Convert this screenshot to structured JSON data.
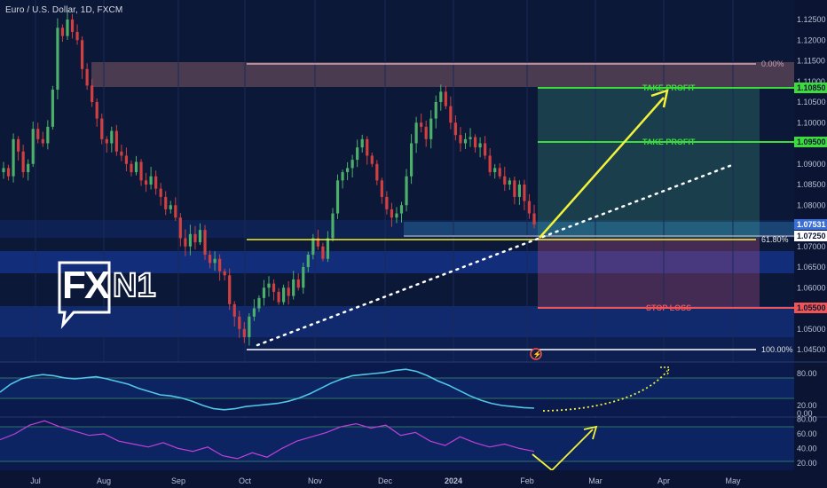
{
  "header": {
    "title": "Euro / U.S. Dollar, 1D, FXCM"
  },
  "logo": {
    "text": "FXN1",
    "part1": "FX",
    "part2": "N1"
  },
  "price_axis": {
    "ticks": [
      "1.12500",
      "1.12000",
      "1.11500",
      "1.11000",
      "1.10500",
      "1.10000",
      "1.09500",
      "1.09000",
      "1.08500",
      "1.08000",
      "1.07500",
      "1.07000",
      "1.06500",
      "1.06000",
      "1.05500",
      "1.05000",
      "1.04500"
    ]
  },
  "price_boxes": {
    "tp_upper": "1.10850",
    "tp_lower": "1.09500",
    "current_1": "1.07531",
    "current_2": "1.07250",
    "stop_loss": "1.05500"
  },
  "levels": {
    "take_profit_1": "TAKE PROFIT",
    "take_profit_2": "TAKE PROFIT",
    "stop_loss": "STOP LOSS",
    "fib_0": "0.00%",
    "fib_618": "61.80%",
    "fib_100": "100.00%"
  },
  "indicator1": {
    "ticks": [
      "80.00",
      "20.00",
      "0.00"
    ]
  },
  "indicator2": {
    "ticks": [
      "80.00",
      "60.00",
      "40.00",
      "20.00"
    ]
  },
  "time_axis": {
    "labels": [
      "Jul",
      "Aug",
      "Sep",
      "Oct",
      "Nov",
      "Dec",
      "2024",
      "Feb",
      "Mar",
      "Apr",
      "May"
    ]
  },
  "colors": {
    "up_candle": "#4caf6a",
    "down_candle": "#d04040",
    "take_profit": "#3ddc3d",
    "stop_loss": "#f05454",
    "yellow": "#f2f23a",
    "osc1": "#52c6e6",
    "osc2": "#c040d8"
  },
  "chart_data": {
    "type": "candlestick",
    "symbol": "Euro / U.S. Dollar",
    "timeframe": "1D",
    "source": "FXCM",
    "y_range": [
      1.0425,
      1.1265
    ],
    "x_labels": [
      "Jul",
      "Aug",
      "Sep",
      "Oct",
      "Nov",
      "Dec",
      "2024",
      "Feb",
      "Mar",
      "Apr",
      "May"
    ],
    "close_series": [
      1.089,
      1.087,
      1.096,
      1.093,
      1.088,
      1.09,
      1.0985,
      1.096,
      1.095,
      1.099,
      1.108,
      1.123,
      1.121,
      1.125,
      1.122,
      1.12,
      1.113,
      1.109,
      1.105,
      1.101,
      1.096,
      1.095,
      1.098,
      1.093,
      1.092,
      1.09,
      1.088,
      1.0905,
      1.086,
      1.085,
      1.087,
      1.084,
      1.082,
      1.079,
      1.08,
      1.077,
      1.072,
      1.07,
      1.073,
      1.071,
      1.074,
      1.068,
      1.066,
      1.067,
      1.064,
      1.063,
      1.056,
      1.053,
      1.05,
      1.048,
      1.053,
      1.055,
      1.0575,
      1.06,
      1.061,
      1.059,
      1.0565,
      1.06,
      1.058,
      1.062,
      1.06,
      1.065,
      1.068,
      1.072,
      1.07,
      1.067,
      1.072,
      1.078,
      1.086,
      1.088,
      1.089,
      1.091,
      1.094,
      1.096,
      1.092,
      1.09,
      1.086,
      1.082,
      1.079,
      1.077,
      1.078,
      1.08,
      1.087,
      1.095,
      1.1,
      1.099,
      1.096,
      1.101,
      1.105,
      1.1075,
      1.104,
      1.1,
      1.097,
      1.095,
      1.096,
      1.0965,
      1.094,
      1.095,
      1.092,
      1.088,
      1.089,
      1.087,
      1.085,
      1.086,
      1.082,
      1.085,
      1.081,
      1.078,
      1.0753
    ],
    "levels": {
      "fib_0": 1.1145,
      "take_profit_1": 1.1085,
      "take_profit_2": 1.095,
      "current": 1.07531,
      "fib_618": 1.0725,
      "stop_loss": 1.055,
      "fib_100": 1.045
    },
    "indicator1": {
      "ticks": [
        80,
        20,
        0
      ],
      "values": [
        45,
        60,
        70,
        75,
        78,
        76,
        72,
        70,
        72,
        74,
        70,
        65,
        60,
        52,
        46,
        40,
        38,
        34,
        28,
        20,
        14,
        12,
        14,
        18,
        20,
        22,
        24,
        28,
        34,
        42,
        52,
        62,
        70,
        76,
        78,
        80,
        82,
        86,
        88,
        84,
        76,
        66,
        58,
        48,
        38,
        30,
        24,
        20,
        18,
        16,
        15
      ]
    },
    "indicator2": {
      "ticks": [
        80,
        60,
        40,
        20
      ],
      "values": [
        52,
        60,
        72,
        78,
        70,
        64,
        58,
        60,
        50,
        46,
        42,
        48,
        40,
        36,
        42,
        30,
        26,
        34,
        28,
        40,
        50,
        56,
        62,
        70,
        74,
        68,
        72,
        58,
        62,
        50,
        44,
        56,
        48,
        42,
        46,
        40,
        36
      ]
    }
  }
}
